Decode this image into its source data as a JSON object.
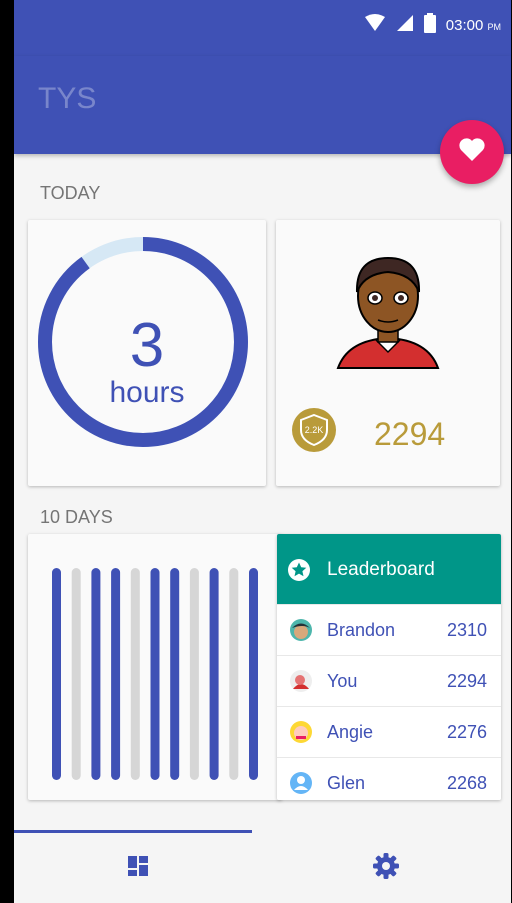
{
  "status_bar": {
    "time": "03:00",
    "ampm": "PM"
  },
  "app": {
    "title": "TYS"
  },
  "today": {
    "label": "TODAY",
    "hours_value": "3",
    "hours_unit": "hours",
    "progress_fraction": 0.9,
    "badge_label": "2.2K",
    "score": "2294"
  },
  "ten_days": {
    "label": "10 DAYS",
    "bars": [
      "highlight",
      "plain",
      "highlight",
      "highlight",
      "plain",
      "highlight",
      "highlight",
      "plain",
      "highlight",
      "plain",
      "highlight"
    ]
  },
  "leaderboard": {
    "title": "Leaderboard",
    "entries": [
      {
        "name": "Brandon",
        "points": "2310"
      },
      {
        "name": "You",
        "points": "2294"
      },
      {
        "name": "Angie",
        "points": "2276"
      },
      {
        "name": "Glen",
        "points": "2268"
      }
    ]
  },
  "colors": {
    "primary": "#3f51b5",
    "accent": "#e91e63",
    "teal": "#009688",
    "gold": "#b99b3a"
  },
  "nav": {
    "active_tab": "dashboard"
  }
}
